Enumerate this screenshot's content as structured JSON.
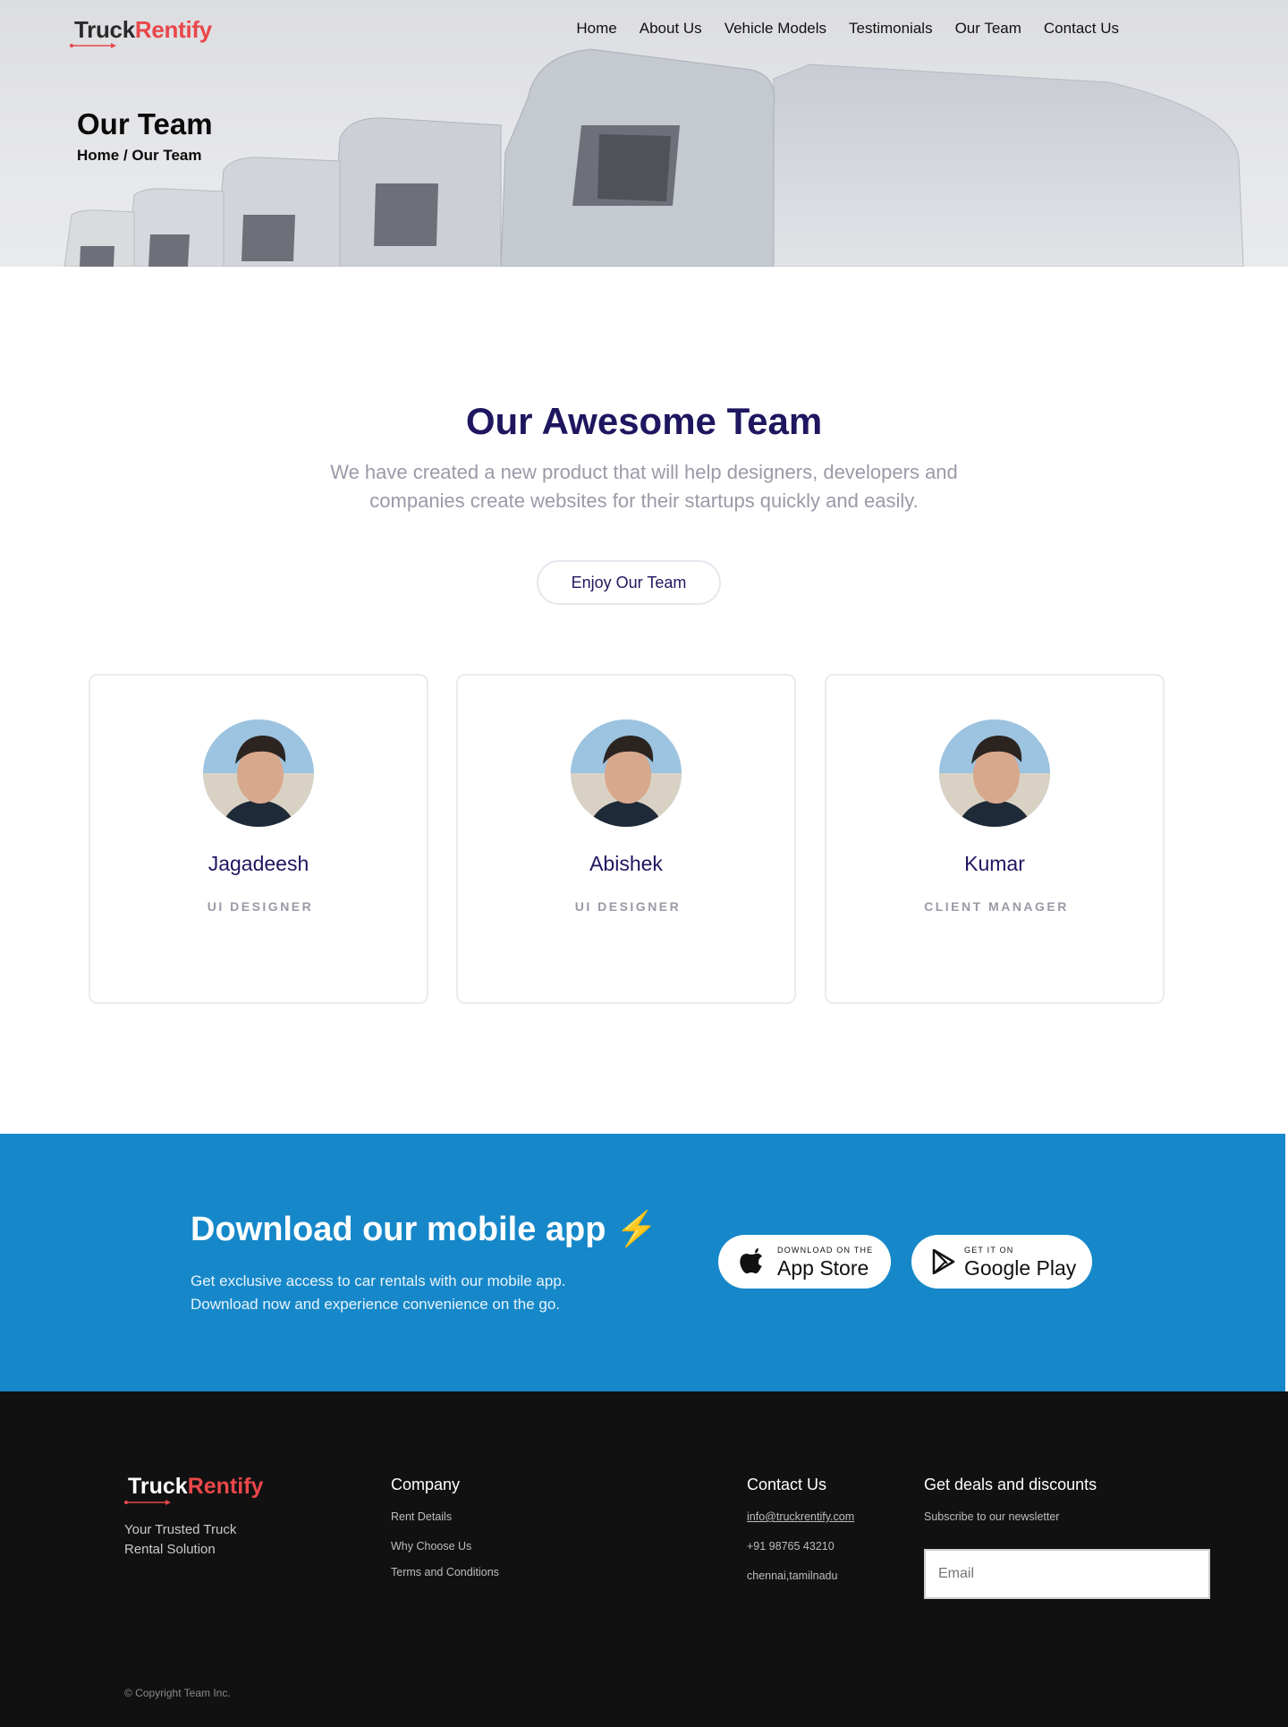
{
  "brand": {
    "part1": "Truck",
    "part2": "Rentify"
  },
  "nav": {
    "items": [
      "Home",
      "About Us",
      "Vehicle Models",
      "Testimonials",
      "Our Team",
      "Contact Us"
    ]
  },
  "hero": {
    "title": "Our Team",
    "breadcrumb": "Home / Our Team"
  },
  "team_section": {
    "heading": "Our Awesome Team",
    "subtitle": "We have created a new product that will help designers, developers and companies create websites for their startups quickly and easily.",
    "button": "Enjoy Our Team",
    "members": [
      {
        "name": "Jagadeesh",
        "role": "UI DESIGNER"
      },
      {
        "name": "Abishek",
        "role": "UI DESIGNER"
      },
      {
        "name": "Kumar",
        "role": "CLIENT MANAGER"
      }
    ]
  },
  "app_section": {
    "heading": "Download our mobile app",
    "bolt": "⚡",
    "text": "Get exclusive access to car rentals with our mobile app. Download now and experience convenience on the go.",
    "appstore": {
      "small": "DOWNLOAD ON THE",
      "big": "App Store"
    },
    "googleplay": {
      "small": "GET IT ON",
      "big": "Google Play"
    }
  },
  "footer": {
    "tagline": "Your Trusted Truck Rental Solution",
    "company": {
      "heading": "Company",
      "links": [
        "Rent Details",
        "Why Choose Us",
        "Terms and Conditions"
      ]
    },
    "contact": {
      "heading": "Contact Us",
      "email": "info@truckrentify.com",
      "phone": "+91 98765 43210",
      "address": "chennai,tamilnadu"
    },
    "deals": {
      "heading": "Get deals and discounts",
      "subtext": "Subscribe to our newsletter",
      "placeholder": "Email"
    },
    "copyright": "© Copyright Team Inc."
  },
  "colors": {
    "accent": "#e9474a",
    "navy": "#1f1660",
    "app_bg": "#1688c9",
    "footer_bg": "#111111"
  },
  "icons": [
    "apple-icon",
    "google-play-icon",
    "logo-arrow-icon"
  ]
}
